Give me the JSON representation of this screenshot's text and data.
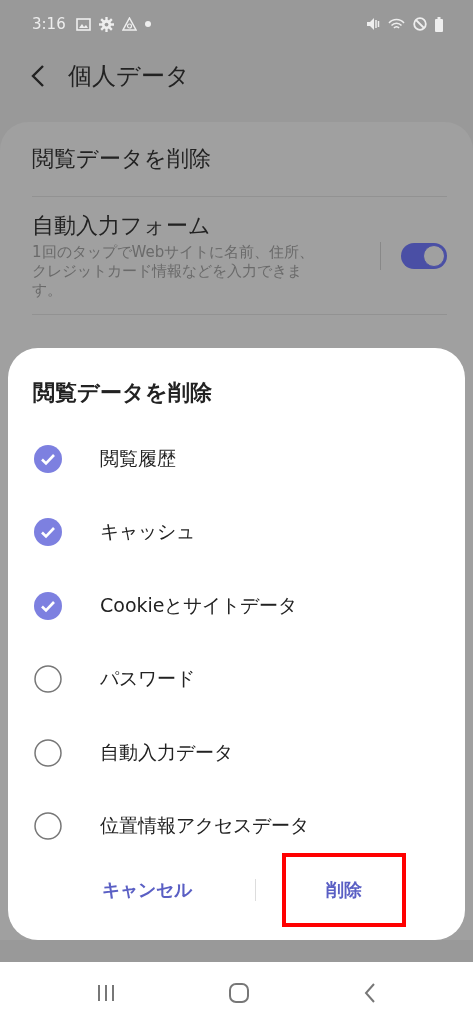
{
  "status_bar": {
    "time": "3:16"
  },
  "header": {
    "title": "個人データ"
  },
  "settings": [
    {
      "kind": "link",
      "label": "閲覧データを削除"
    },
    {
      "kind": "toggle",
      "label": "自動入力フォーム",
      "description": "1回のタップでWebサイトに名前、住所、クレジットカード情報などを入力できます。",
      "on": true
    }
  ],
  "dialog": {
    "title": "閲覧データを削除",
    "options": [
      {
        "label": "閲覧履歴",
        "checked": true
      },
      {
        "label": "キャッシュ",
        "checked": true
      },
      {
        "label": "Cookieとサイトデータ",
        "checked": true
      },
      {
        "label": "パスワード",
        "checked": false
      },
      {
        "label": "自動入力データ",
        "checked": false
      },
      {
        "label": "位置情報アクセスデータ",
        "checked": false
      }
    ],
    "buttons": [
      {
        "label": "キャンセル",
        "highlighted": false
      },
      {
        "label": "削除",
        "highlighted": true
      }
    ]
  }
}
